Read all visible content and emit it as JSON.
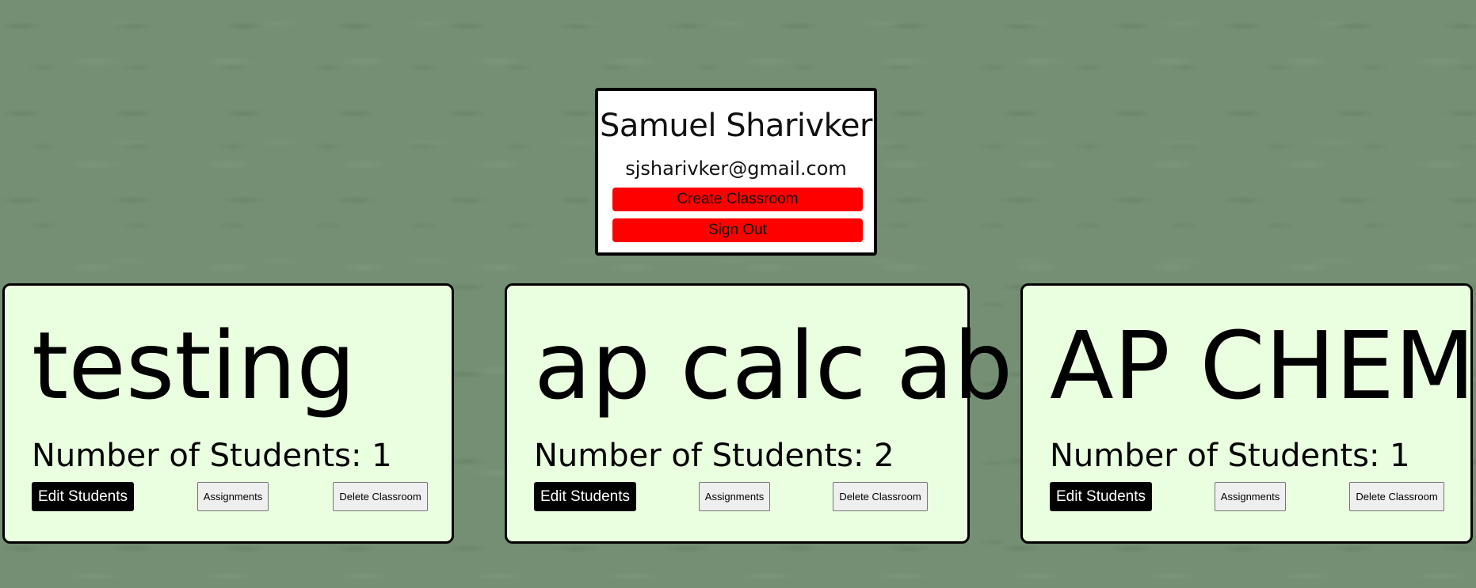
{
  "profile": {
    "name": "Samuel Sharivker",
    "email": "sjsharivker@gmail.com",
    "create_classroom_label": "Create Classroom",
    "sign_out_label": "Sign Out"
  },
  "classrooms": [
    {
      "title": "testing",
      "students_text": "Number of Students: 1",
      "edit_label": "Edit Students",
      "assignments_label": "Assignments",
      "delete_label": "Delete Classroom"
    },
    {
      "title": "ap calc ab",
      "students_text": "Number of Students: 2",
      "edit_label": "Edit Students",
      "assignments_label": "Assignments",
      "delete_label": "Delete Classroom"
    },
    {
      "title": "AP CHEM",
      "students_text": "Number of Students: 1",
      "edit_label": "Edit Students",
      "assignments_label": "Assignments",
      "delete_label": "Delete Classroom"
    }
  ],
  "colors": {
    "background": "#748f74",
    "card_background": "#eaffdf",
    "accent_red": "#ff0000"
  }
}
